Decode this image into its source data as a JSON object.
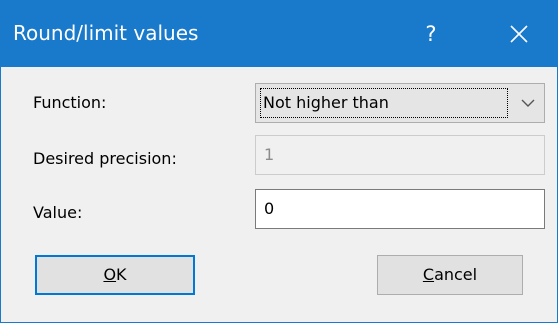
{
  "window": {
    "title": "Round/limit values",
    "help_glyph": "?",
    "title_bar_color": "#1979ca",
    "focus_color": "#0078d7"
  },
  "form": {
    "function_label": "Function:",
    "function_value": "Not higher than",
    "precision_label": "Desired precision:",
    "precision_value": "1",
    "value_label": "Value:",
    "value_value": "0"
  },
  "buttons": {
    "ok_mnemonic": "O",
    "ok_rest": "K",
    "cancel_mnemonic": "C",
    "cancel_rest": "ancel"
  },
  "icons": {
    "help": "help-icon",
    "close": "close-icon",
    "dropdown": "chevron-down-icon"
  }
}
